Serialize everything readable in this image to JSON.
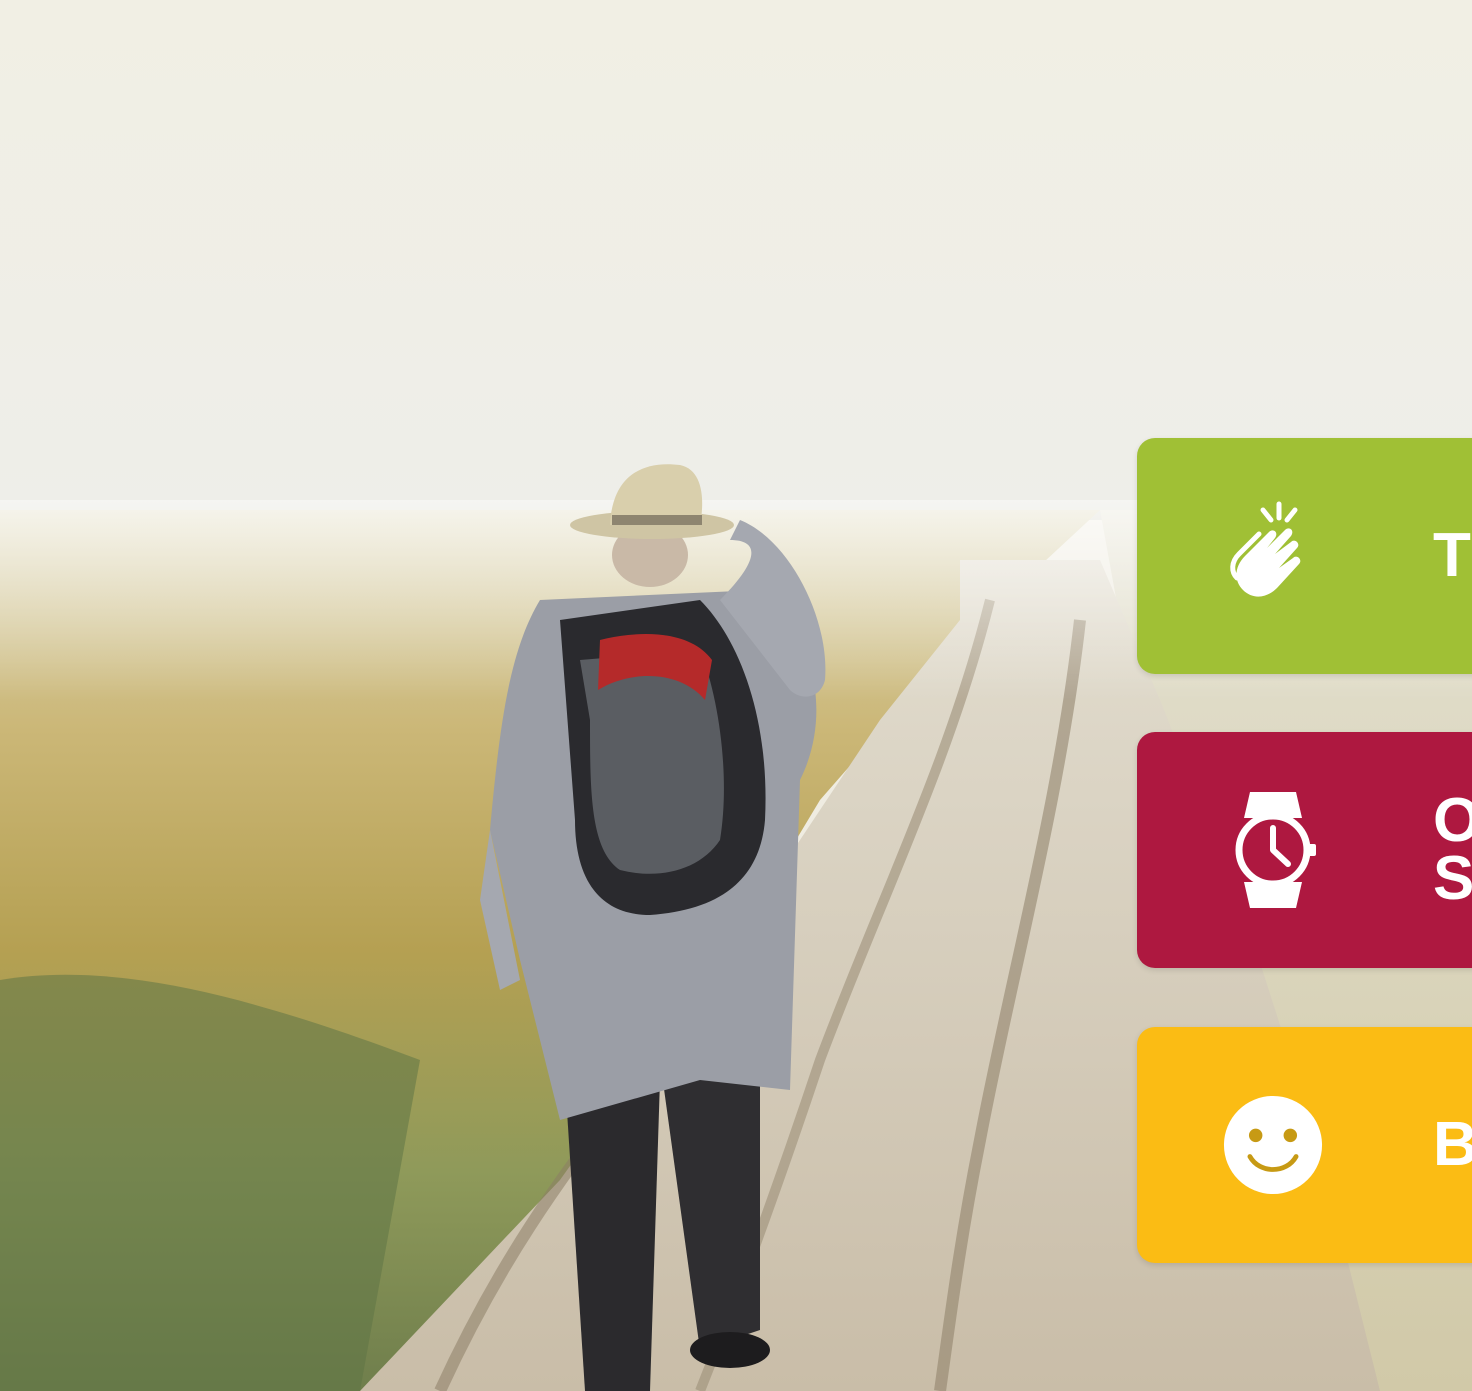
{
  "hero": {
    "image_name": "hiker-walking-on-foggy-dirt-road"
  },
  "cards": [
    {
      "label": "T",
      "icon": "clapping-hands-icon",
      "color": "#a0c035"
    },
    {
      "label": "O\nS",
      "icon": "wristwatch-icon",
      "color": "#ae1840"
    },
    {
      "label": "B",
      "icon": "smiley-face-icon",
      "color": "#fbbc14"
    }
  ]
}
